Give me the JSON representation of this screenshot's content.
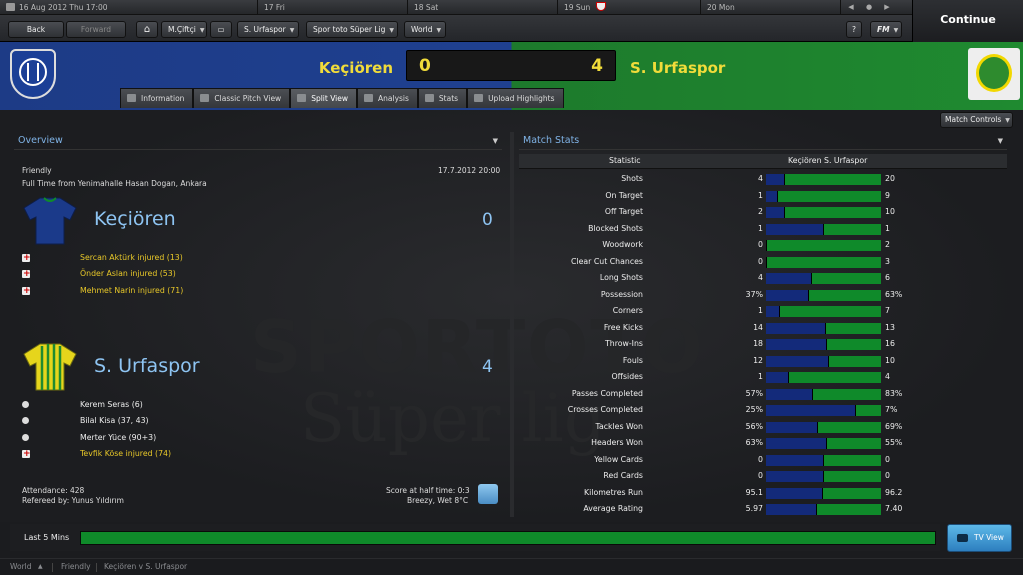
{
  "topbar": {
    "date": "16 Aug 2012 Thu 17:00",
    "days": [
      "17 Fri",
      "18 Sat",
      "19 Sun",
      "20 Mon"
    ]
  },
  "continue_label": "Continue",
  "nav": {
    "back": "Back",
    "forward": "Forward",
    "manager": "M.Çiftçi",
    "club": "S. Urfaspor",
    "league": "Spor toto Süper Lig",
    "world": "World",
    "fm": "FM",
    "help": "?"
  },
  "match": {
    "home_team": "Keçiören",
    "away_team": "S. Urfaspor",
    "home_score": "0",
    "away_score": "4"
  },
  "tabs": [
    "Information",
    "Classic Pitch View",
    "Split View",
    "Analysis",
    "Stats",
    "Upload Highlights"
  ],
  "match_controls": "Match Controls",
  "overview": {
    "title": "Overview",
    "competition": "Friendly",
    "datetime": "17.7.2012 20:00",
    "venue": "Full Time from Yenimahalle Hasan Dogan, Ankara",
    "home_team": "Keçiören",
    "home_score": "0",
    "home_events": [
      "Sercan Aktürk injured (13)",
      "Önder Aslan injured (53)",
      "Mehmet Narin injured (71)"
    ],
    "away_team": "S. Urfaspor",
    "away_score": "4",
    "away_goals": [
      "Kerem Seras (6)",
      "Bilal Kisa (37, 43)",
      "Merter Yüce (90+3)"
    ],
    "away_injury": "Tevfik Köse injured (74)",
    "attendance": "Attendance: 428",
    "referee": "Refereed by: Yunus Yıldırım",
    "halftime": "Score at half time: 0:3",
    "weather": "Breezy, Wet 8°C"
  },
  "stats": {
    "title": "Match Stats",
    "col_statistic": "Statistic",
    "col_home": "Keçiören",
    "col_away": "S. Urfaspor",
    "rows": [
      {
        "label": "Shots",
        "home": "4",
        "away": "20",
        "home_share": 0.167
      },
      {
        "label": "On Target",
        "home": "1",
        "away": "9",
        "home_share": 0.1
      },
      {
        "label": "Off Target",
        "home": "2",
        "away": "10",
        "home_share": 0.167
      },
      {
        "label": "Blocked Shots",
        "home": "1",
        "away": "1",
        "home_share": 0.5
      },
      {
        "label": "Woodwork",
        "home": "0",
        "away": "2",
        "home_share": 0.0
      },
      {
        "label": "Clear Cut Chances",
        "home": "0",
        "away": "3",
        "home_share": 0.0
      },
      {
        "label": "Long Shots",
        "home": "4",
        "away": "6",
        "home_share": 0.4
      },
      {
        "label": "Possession",
        "home": "37%",
        "away": "63%",
        "home_share": 0.37
      },
      {
        "label": "Corners",
        "home": "1",
        "away": "7",
        "home_share": 0.125
      },
      {
        "label": "Free Kicks",
        "home": "14",
        "away": "13",
        "home_share": 0.519
      },
      {
        "label": "Throw-Ins",
        "home": "18",
        "away": "16",
        "home_share": 0.529
      },
      {
        "label": "Fouls",
        "home": "12",
        "away": "10",
        "home_share": 0.545
      },
      {
        "label": "Offsides",
        "home": "1",
        "away": "4",
        "home_share": 0.2
      },
      {
        "label": "Passes Completed",
        "home": "57%",
        "away": "83%",
        "home_share": 0.407
      },
      {
        "label": "Crosses Completed",
        "home": "25%",
        "away": "7%",
        "home_share": 0.781
      },
      {
        "label": "Tackles Won",
        "home": "56%",
        "away": "69%",
        "home_share": 0.448
      },
      {
        "label": "Headers Won",
        "home": "63%",
        "away": "55%",
        "home_share": 0.534
      },
      {
        "label": "Yellow Cards",
        "home": "0",
        "away": "0",
        "home_share": 0.5
      },
      {
        "label": "Red Cards",
        "home": "0",
        "away": "0",
        "home_share": 0.5
      },
      {
        "label": "Kilometres Run",
        "home": "95.1",
        "away": "96.2",
        "home_share": 0.497
      },
      {
        "label": "Average Rating",
        "home": "5.97",
        "away": "7.40",
        "home_share": 0.447
      }
    ]
  },
  "watermark": {
    "line1": "SPORTOTO",
    "line2": "Süper lig"
  },
  "last5": {
    "label": "Last 5 Mins"
  },
  "tv_view": "TV View",
  "statusbar": {
    "world": "World",
    "friendly": "Friendly",
    "match": "Keçiören v S. Urfaspor"
  },
  "colors": {
    "home": "#132a7a",
    "away": "#0f8a2a",
    "accent_yellow": "#f1dc3a",
    "panel_title": "#7fb3e6"
  }
}
